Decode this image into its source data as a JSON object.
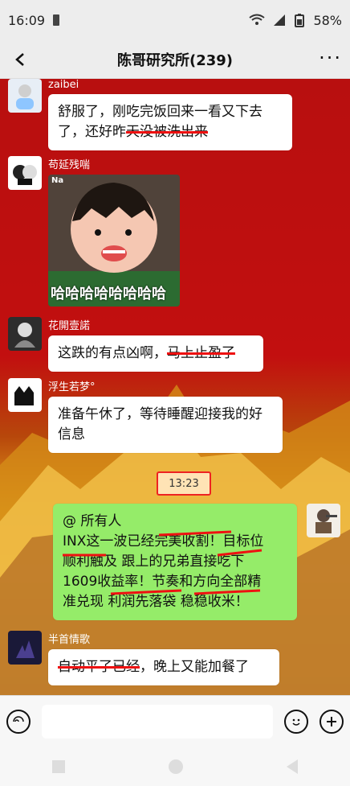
{
  "status": {
    "time": "16:09",
    "battery": "58%"
  },
  "header": {
    "title": "陈哥研究所(239)",
    "more": "···"
  },
  "messages": [
    {
      "name": "zaibei",
      "text_plain": "舒服了，刚吃完饭回来一看又下去了，还好昨",
      "text_strike": "天没被洗出来"
    },
    {
      "name": "苟延残喘",
      "sticker_text": "哈哈哈哈哈哈哈哈",
      "sticker_tag": "Na"
    },
    {
      "name": "花開壹諾",
      "text_plain": "这跌的有点凶啊，",
      "text_strike": "马上止盈了"
    },
    {
      "name": "浮生若梦°",
      "text": "准备午休了，等待睡醒迎接我的好信息"
    },
    {
      "time": "13:23"
    },
    {
      "green_lines": [
        "@ 所有人",
        "INX这一波已经完美收割！目标位",
        "顺利触及 跟上的兄弟直接吃下",
        "1609收益率！节奏和方向全部精",
        "准兑现 利润先落袋 稳稳收米！"
      ]
    },
    {
      "name": "半首情歌",
      "text_strike": "自动平了已经",
      "text_plain": "，晚上又能加餐了"
    }
  ]
}
